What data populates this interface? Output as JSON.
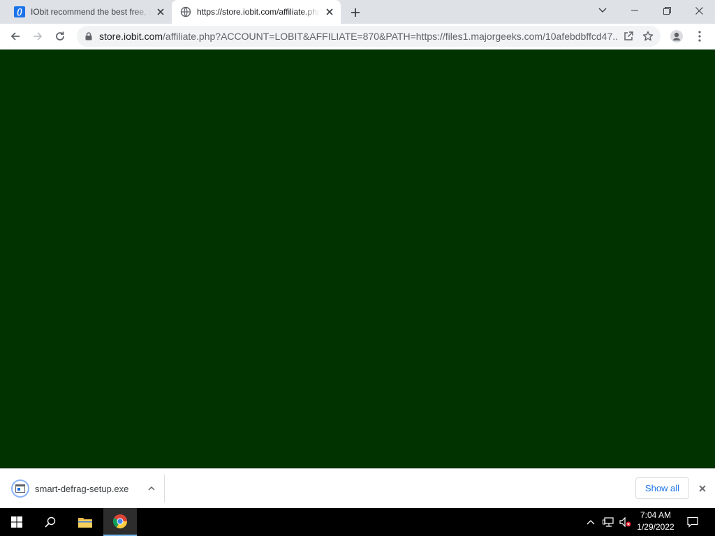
{
  "browser": {
    "tabs": [
      {
        "title": "IObit recommend the best free, safe",
        "favicon": "iobit-icon",
        "active": false
      },
      {
        "title": "https://store.iobit.com/affiliate.php",
        "favicon": "globe-icon",
        "active": true
      }
    ],
    "address": {
      "host": "store.iobit.com",
      "path": "/affiliate.php?ACCOUNT=LOBIT&AFFILIATE=870&PATH=https://files1.majorgeeks.com/10afebdbffcd47..."
    }
  },
  "page": {
    "background": "#003300"
  },
  "download_shelf": {
    "filename": "smart-defrag-setup.exe",
    "show_all_label": "Show all"
  },
  "taskbar": {
    "time": "7:04 AM",
    "date": "1/29/2022"
  }
}
